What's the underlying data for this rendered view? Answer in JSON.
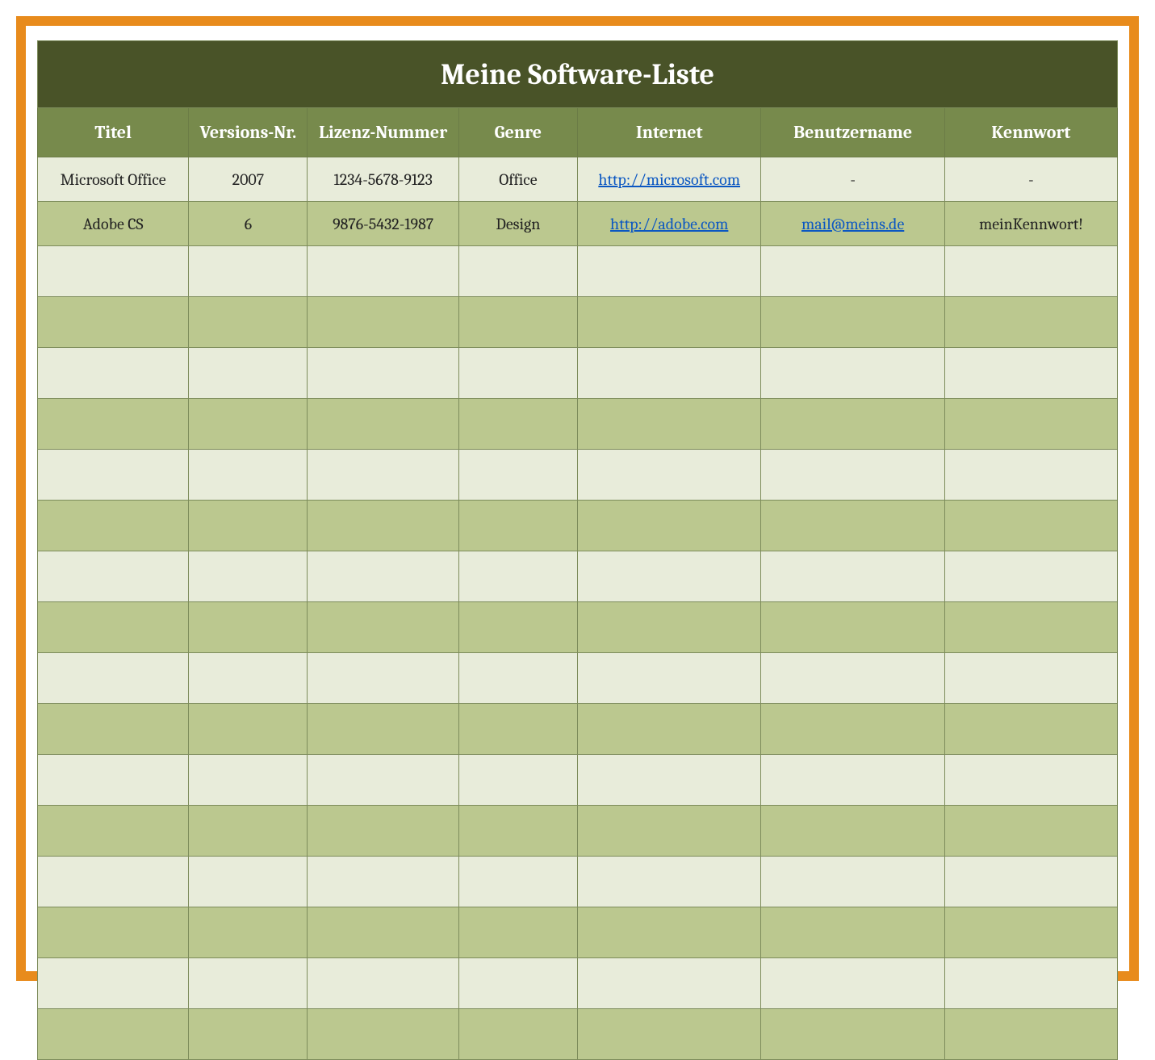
{
  "title": "Meine Software-Liste",
  "columns": [
    "Titel",
    "Versions-Nr.",
    "Lizenz-Nummer",
    "Genre",
    "Internet",
    "Benutzername",
    "Kennwort"
  ],
  "rows": [
    {
      "titel": "Microsoft Office",
      "version": "2007",
      "lizenz": "1234-5678-9123",
      "genre": "Office",
      "internet": "http://microsoft.com",
      "internet_is_link": true,
      "benutzer": "-",
      "benutzer_is_link": false,
      "kennwort": "-"
    },
    {
      "titel": "Adobe CS",
      "version": "6",
      "lizenz": "9876-5432-1987",
      "genre": "Design",
      "internet": "http://adobe.com",
      "internet_is_link": true,
      "benutzer": "mail@meins.de",
      "benutzer_is_link": true,
      "kennwort": "meinKennwort!"
    }
  ],
  "empty_row_count": 16
}
